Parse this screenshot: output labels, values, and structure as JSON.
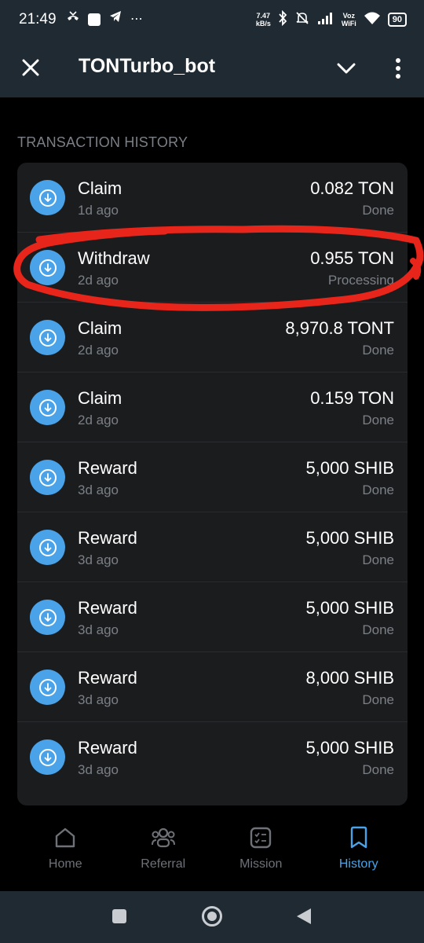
{
  "status_bar": {
    "time": "21:49",
    "speed": "7.47",
    "speed_unit": "kB/s",
    "network": "Voz WiFi",
    "network_top": "Voz",
    "network_bottom": "WiFi",
    "battery": "90",
    "icons": [
      "missed-call-icon",
      "app-square-icon",
      "telegram-icon",
      "more-dots-icon",
      "bluetooth-icon",
      "mute-icon",
      "signal-icon",
      "wifi-icon",
      "battery-icon"
    ]
  },
  "header": {
    "title": "TONTurbo_bot",
    "close_icon": "close-icon",
    "dropdown_icon": "chevron-down-icon",
    "menu_icon": "kebab-menu-icon"
  },
  "section_title": "TRANSACTION HISTORY",
  "transactions": [
    {
      "type": "Claim",
      "time": "1d ago",
      "amount": "0.082 TON",
      "status": "Done"
    },
    {
      "type": "Withdraw",
      "time": "2d ago",
      "amount": "0.955 TON",
      "status": "Processing"
    },
    {
      "type": "Claim",
      "time": "2d ago",
      "amount": "8,970.8 TONT",
      "status": "Done"
    },
    {
      "type": "Claim",
      "time": "2d ago",
      "amount": "0.159 TON",
      "status": "Done"
    },
    {
      "type": "Reward",
      "time": "3d ago",
      "amount": "5,000 SHIB",
      "status": "Done"
    },
    {
      "type": "Reward",
      "time": "3d ago",
      "amount": "5,000 SHIB",
      "status": "Done"
    },
    {
      "type": "Reward",
      "time": "3d ago",
      "amount": "5,000 SHIB",
      "status": "Done"
    },
    {
      "type": "Reward",
      "time": "3d ago",
      "amount": "8,000 SHIB",
      "status": "Done"
    },
    {
      "type": "Reward",
      "time": "3d ago",
      "amount": "5,000 SHIB",
      "status": "Done"
    }
  ],
  "tabs": [
    {
      "label": "Home",
      "icon": "home-icon",
      "active": false
    },
    {
      "label": "Referral",
      "icon": "referral-icon",
      "active": false
    },
    {
      "label": "Mission",
      "icon": "mission-icon",
      "active": false
    },
    {
      "label": "History",
      "icon": "history-icon",
      "active": true
    }
  ],
  "colors": {
    "accent": "#4aa3e8",
    "header_bg": "#1f2a33",
    "card_bg": "#1b1c1e",
    "muted_text": "#7b7f86",
    "annotation": "#e8251a"
  }
}
